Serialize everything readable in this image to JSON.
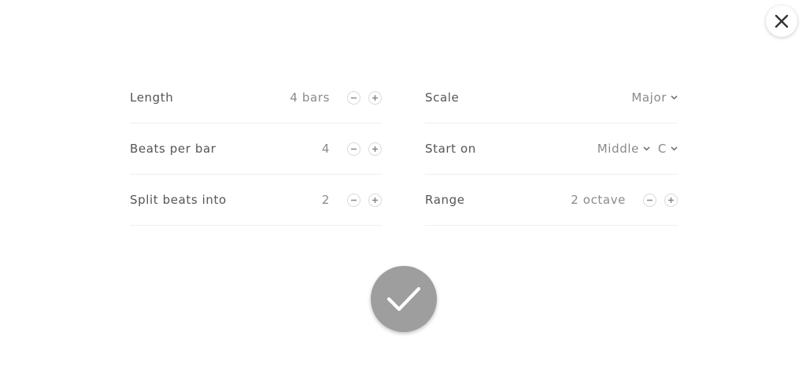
{
  "settings_left": {
    "length": {
      "label": "Length",
      "value": "4 bars"
    },
    "beats_per_bar": {
      "label": "Beats per bar",
      "value": "4"
    },
    "split_beats": {
      "label": "Split beats into",
      "value": "2"
    }
  },
  "settings_right": {
    "scale": {
      "label": "Scale",
      "value": "Major"
    },
    "start_on": {
      "label": "Start on",
      "octave_value": "Middle",
      "note_value": "C"
    },
    "range": {
      "label": "Range",
      "value": "2 octave"
    }
  },
  "icons": {
    "close": "close-icon",
    "decrement": "minus-icon",
    "increment": "plus-icon",
    "dropdown": "chevron-down-icon",
    "confirm": "checkmark-icon"
  },
  "colors": {
    "confirm_button": "#9e9e9e",
    "label_text": "#555555",
    "value_text": "#8a8a8a",
    "divider": "#efefef"
  }
}
